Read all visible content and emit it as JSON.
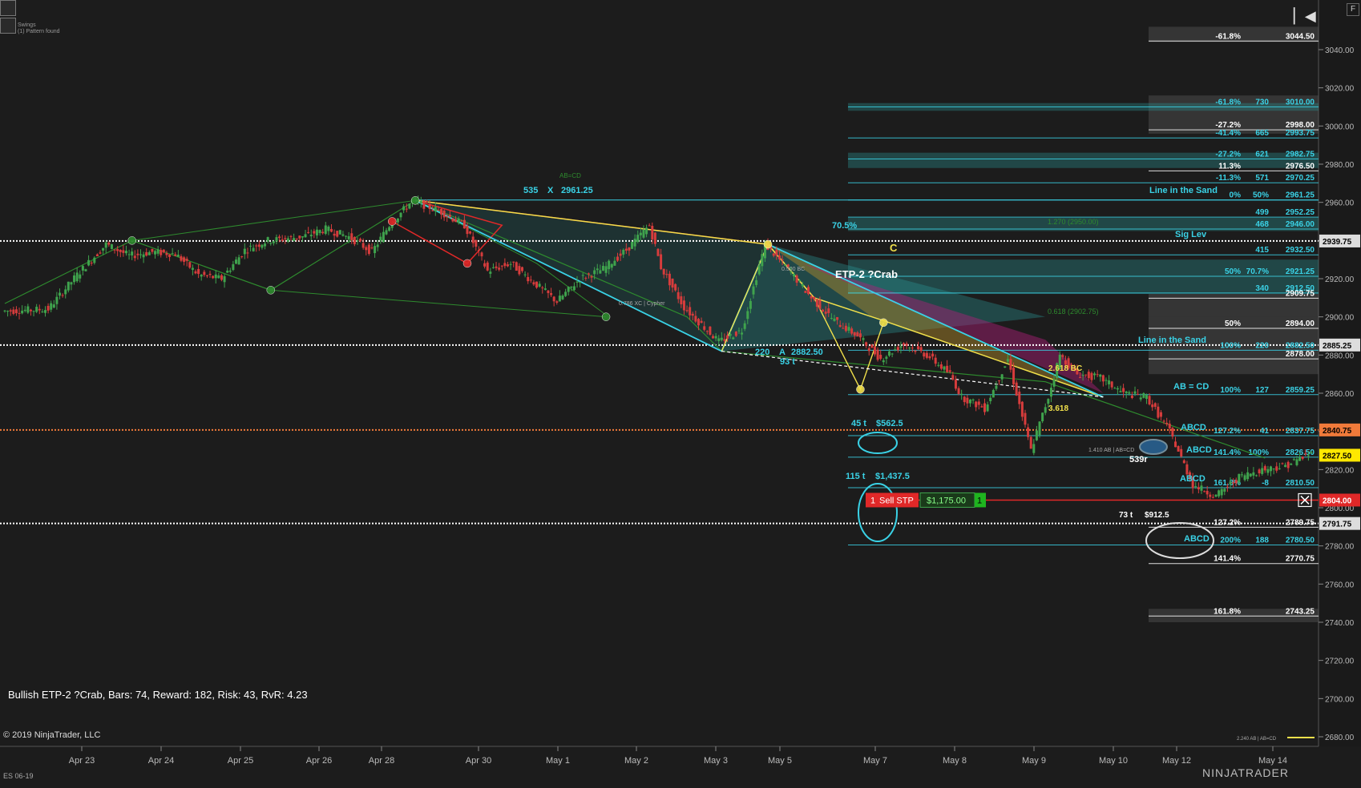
{
  "ui": {
    "legend_lines": [
      "Swings",
      "(1) Pattern found"
    ],
    "info_text": "Bullish ETP-2 ?Crab, Bars: 74, Reward: 182, Risk: 43, RvR: 4.23",
    "copyright": "© 2019 NinjaTrader, LLC",
    "series_tag": "ES 06-19",
    "brand": "NINJATRADER",
    "f_button": "F"
  },
  "colors": {
    "background": "#1c1c1c",
    "bull_candle": "#3fa34d",
    "bear_candle": "#d63c3c",
    "cyan": "#3ad2e6",
    "yellow": "#f1e04b",
    "orange": "#f07a3a",
    "green_line": "#2e8b2e",
    "red_line": "#e02828",
    "magenta": "#b0207a"
  },
  "chart_data": {
    "type": "candlestick",
    "x_tick_labels": [
      "Apr 23",
      "Apr 24",
      "Apr 25",
      "Apr 26",
      "Apr 28",
      "Apr 30",
      "May 1",
      "May 2",
      "May 3",
      "May 5",
      "May 7",
      "May 8",
      "May 9",
      "May 10",
      "May 12",
      "May 14"
    ],
    "ylim": [
      2680,
      3050
    ],
    "y_ticks": [
      2680,
      2700,
      2720,
      2740,
      2760,
      2780,
      2800,
      2820,
      2840,
      2860,
      2880,
      2900,
      2920,
      2940,
      2960,
      2980,
      3000,
      3020,
      3040
    ],
    "price_path": [
      [
        0,
        2903
      ],
      [
        8,
        2904
      ],
      [
        13,
        2922
      ],
      [
        18,
        2938
      ],
      [
        22,
        2932
      ],
      [
        26,
        2934
      ],
      [
        30,
        2933
      ],
      [
        34,
        2922
      ],
      [
        38,
        2920
      ],
      [
        42,
        2935
      ],
      [
        46,
        2940
      ],
      [
        52,
        2942
      ],
      [
        56,
        2946
      ],
      [
        60,
        2942
      ],
      [
        64,
        2934
      ],
      [
        67,
        2948
      ],
      [
        71,
        2961
      ],
      [
        76,
        2955
      ],
      [
        80,
        2948
      ],
      [
        84,
        2924
      ],
      [
        88,
        2928
      ],
      [
        92,
        2918
      ],
      [
        96,
        2908
      ],
      [
        100,
        2920
      ],
      [
        104,
        2925
      ],
      [
        108,
        2935
      ],
      [
        112,
        2948
      ],
      [
        114,
        2926
      ],
      [
        118,
        2905
      ],
      [
        124,
        2887
      ],
      [
        128,
        2893
      ],
      [
        132,
        2938
      ],
      [
        136,
        2925
      ],
      [
        140,
        2910
      ],
      [
        144,
        2898
      ],
      [
        148,
        2890
      ],
      [
        152,
        2878
      ],
      [
        156,
        2886
      ],
      [
        160,
        2880
      ],
      [
        164,
        2870
      ],
      [
        166,
        2858
      ],
      [
        170,
        2852
      ],
      [
        174,
        2878
      ],
      [
        178,
        2830
      ],
      [
        181,
        2858
      ],
      [
        183,
        2880
      ],
      [
        186,
        2870
      ],
      [
        190,
        2868
      ],
      [
        194,
        2860
      ],
      [
        198,
        2858
      ],
      [
        202,
        2840
      ],
      [
        206,
        2812
      ],
      [
        210,
        2806
      ],
      [
        214,
        2816
      ],
      [
        218,
        2820
      ],
      [
        222,
        2822
      ],
      [
        226,
        2828
      ]
    ],
    "candle_range": [
      0,
      226
    ],
    "axis_price_labels": [
      {
        "price": 2939.75,
        "label": "2939.75",
        "style": "white"
      },
      {
        "price": 2885.25,
        "label": "2885.25",
        "style": "white"
      },
      {
        "price": 2840.75,
        "label": "2840.75",
        "style": "orange"
      },
      {
        "price": 2827.5,
        "label": "2827.50",
        "style": "yellow"
      },
      {
        "price": 2804.0,
        "label": "2804.00",
        "style": "red"
      },
      {
        "price": 2791.75,
        "label": "2791.75",
        "style": "white"
      }
    ],
    "dotted_levels": [
      {
        "price": 2939.75,
        "color": "#ffffff"
      },
      {
        "price": 2885.25,
        "color": "#ffffff"
      },
      {
        "price": 2840.75,
        "color": "#f07a3a"
      },
      {
        "price": 2791.75,
        "color": "#ffffff"
      }
    ],
    "fib_right": [
      {
        "price": 3044.5,
        "pct": "-61.8%",
        "color": "#ffffff"
      },
      {
        "price": 3010.0,
        "pct": "-61.8%",
        "n": "730",
        "color": "#3ad2e6"
      },
      {
        "price": 2998.0,
        "pct": "-27.2%",
        "color": "#ffffff"
      },
      {
        "price": 2993.75,
        "pct": "-41.4%",
        "n": "665",
        "color": "#3ad2e6"
      },
      {
        "price": 2982.75,
        "pct": "-27.2%",
        "n": "621",
        "color": "#3ad2e6"
      },
      {
        "price": 2976.5,
        "pct": "11.3%",
        "color": "#ffffff"
      },
      {
        "price": 2970.25,
        "pct": "-11.3%",
        "n": "571",
        "color": "#3ad2e6"
      },
      {
        "price": 2961.25,
        "pct": "0%",
        "n": "50%",
        "color": "#3ad2e6"
      },
      {
        "price": 2952.25,
        "n": "499",
        "color": "#3ad2e6"
      },
      {
        "price": 2946.0,
        "n": "468",
        "color": "#3ad2e6"
      },
      {
        "price": 2932.5,
        "n": "415",
        "color": "#3ad2e6"
      },
      {
        "price": 2921.25,
        "pct": "50%",
        "n": "70.7%",
        "color": "#3ad2e6"
      },
      {
        "price": 2912.5,
        "n": "340",
        "color": "#3ad2e6"
      },
      {
        "price": 2909.75,
        "color": "#ffffff"
      },
      {
        "price": 2894.0,
        "pct": "50%",
        "color": "#ffffff"
      },
      {
        "price": 2882.5,
        "pct": "100%",
        "n": "220",
        "color": "#3ad2e6"
      },
      {
        "price": 2878.0,
        "color": "#ffffff"
      },
      {
        "price": 2859.25,
        "pct": "100%",
        "n": "127",
        "color": "#3ad2e6"
      },
      {
        "price": 2837.75,
        "pct": "127.2%",
        "n": "41",
        "color": "#3ad2e6"
      },
      {
        "price": 2826.5,
        "pct": "141.4%",
        "n": "100%",
        "color": "#3ad2e6"
      },
      {
        "price": 2810.5,
        "pct": "161.8%",
        "n": "-8",
        "color": "#3ad2e6"
      },
      {
        "price": 2789.75,
        "pct": "127.2%",
        "color": "#ffffff"
      },
      {
        "price": 2780.5,
        "pct": "200%",
        "n": "188",
        "color": "#3ad2e6"
      },
      {
        "price": 2770.75,
        "pct": "141.4%",
        "color": "#ffffff"
      },
      {
        "price": 2743.25,
        "pct": "161.8%",
        "color": "#ffffff"
      }
    ],
    "annotations": [
      {
        "text": "535",
        "color": "#3ad2e6"
      },
      {
        "text": "X",
        "color": "#3ad2e6"
      },
      {
        "text": "2961.25",
        "color": "#3ad2e6"
      },
      {
        "text": "AB=CD",
        "color": "#2e8b2e"
      },
      {
        "text": "220",
        "color": "#3ad2e6"
      },
      {
        "text": "A",
        "color": "#3ad2e6"
      },
      {
        "text": "2882.50",
        "color": "#3ad2e6"
      },
      {
        "text": "93 t",
        "color": "#3ad2e6"
      },
      {
        "text": "70.5%",
        "color": "#3ad2e6"
      },
      {
        "text": "C",
        "color": "#f1e04b"
      },
      {
        "text": "ETP-2 ?Crab",
        "color": "#ffffff"
      },
      {
        "text": "Line in the Sand",
        "color": "#3ad2e6"
      },
      {
        "text": "Line in the Sand",
        "color": "#3ad2e6"
      },
      {
        "text": "Sig Lev",
        "color": "#3ad2e6"
      },
      {
        "text": "AB = CD",
        "color": "#3ad2e6"
      },
      {
        "text": "ABCD",
        "color": "#3ad2e6"
      },
      {
        "text": "ABCD",
        "color": "#3ad2e6"
      },
      {
        "text": "ABCD",
        "color": "#3ad2e6"
      },
      {
        "text": "ABCD",
        "color": "#3ad2e6"
      },
      {
        "text": "45 t",
        "color": "#3ad2e6"
      },
      {
        "text": "$562.5",
        "color": "#3ad2e6"
      },
      {
        "text": "115 t",
        "color": "#3ad2e6"
      },
      {
        "text": "$1,437.5",
        "color": "#3ad2e6"
      },
      {
        "text": "73 t",
        "color": "#ffffff"
      },
      {
        "text": "$912.5",
        "color": "#ffffff"
      },
      {
        "text": "539r",
        "color": "#ffffff"
      },
      {
        "text": "2.618 BC",
        "color": "#f1e04b"
      },
      {
        "text": "3.618",
        "color": "#f1e04b"
      },
      {
        "text": "1.270 (2950.00)",
        "color": "#2e8b2e"
      },
      {
        "text": "0.618 (2902.75)",
        "color": "#2e8b2e"
      },
      {
        "text": "0.786 XC | Cypher",
        "color": "#aaa"
      },
      {
        "text": "0.500 BC",
        "color": "#aaa"
      },
      {
        "text": "1.410 AB | AB=CD",
        "color": "#aaa"
      },
      {
        "text": "2.240 AB | AB=CD",
        "color": "#aaa"
      }
    ],
    "order": {
      "qty": "1",
      "side_label": "Sell STP",
      "pnl": "$1,175.00",
      "qty_right": "1",
      "price": 2804.0
    }
  }
}
